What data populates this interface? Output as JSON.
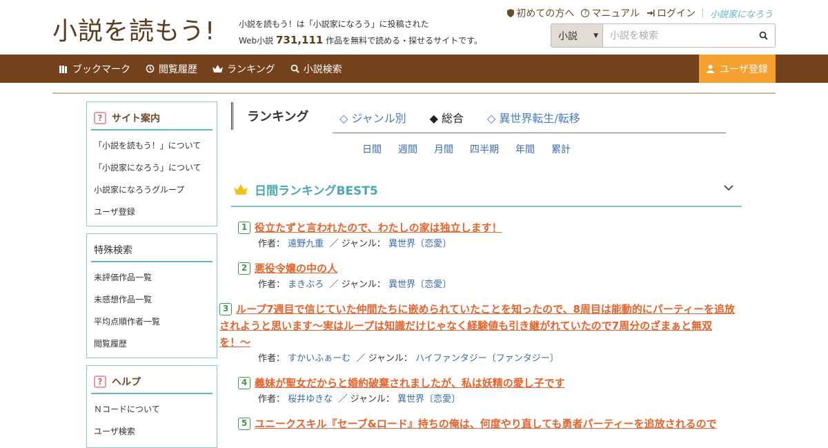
{
  "site": {
    "logo": "小説を読もう!",
    "tagline_1": "小説を読もう！は「小説家になろう」に投稿された",
    "tagline_2_prefix": "Web小説",
    "work_count": "731,111",
    "tagline_2_suffix": "作品を無料で読める・探せるサイトです。",
    "brand_link": "小説家になろう"
  },
  "toplinks": {
    "beginners": "初めての方へ",
    "manual": "マニュアル",
    "login": "ログイン"
  },
  "search": {
    "category": "小説",
    "placeholder": "小説を検索"
  },
  "nav": {
    "bookmark": "ブックマーク",
    "history": "閲覧履歴",
    "ranking": "ランキング",
    "search": "小説検索",
    "register": "ユーザ登録"
  },
  "sidebar": {
    "guide": {
      "title": "サイト案内",
      "items": [
        "「小説を読もう！」について",
        "「小説家になろう」について",
        "小説家になろうグループ",
        "ユーザ登録"
      ]
    },
    "special": {
      "title": "特殊検索",
      "items": [
        "未評価作品一覧",
        "未感想作品一覧",
        "平均点順作者一覧",
        "閲覧履歴"
      ]
    },
    "help": {
      "title": "ヘルプ",
      "items": [
        "Ｎコードについて",
        "ユーザ検索"
      ]
    }
  },
  "ranking": {
    "title": "ランキング",
    "tabs": [
      "◇ ジャンル別",
      "◆ 総合",
      "◇ 異世界転生/転移"
    ],
    "periods": [
      "日間",
      "週間",
      "月間",
      "四半期",
      "年間",
      "累計"
    ],
    "best_title": "日間ランキングBEST5",
    "author_label": "作者：",
    "genre_label": "／ ジャンル：",
    "entries": [
      {
        "rank": "1",
        "title": "役立たずと言われたので、わたしの家は独立します！",
        "author": "遠野九重",
        "genre": "異世界〔恋愛〕"
      },
      {
        "rank": "2",
        "title": "悪役令嬢の中の人",
        "author": "まきぶろ",
        "genre": "異世界〔恋愛〕"
      },
      {
        "rank": "3",
        "title": "ループ7週目で信じていた仲間たちに嵌められていたことを知ったので、8周目は能動的にパーティーを追放されようと思います〜実はループは知識だけじゃなく経験値も引き継がれていたので7周分のざまぁと無双を！〜",
        "author": "すかいふぁーむ",
        "genre": "ハイファンタジー〔ファンタジー〕"
      },
      {
        "rank": "4",
        "title": "義妹が聖女だからと婚約破棄されましたが、私は妖精の愛し子です",
        "author": "桜井ゆきな",
        "genre": "異世界〔恋愛〕"
      },
      {
        "rank": "5",
        "title": "ユニークスキル『セーブ&ロード』持ちの俺は、何度やり直しても勇者パーティーを追放されるので",
        "author": "",
        "genre": ""
      }
    ]
  }
}
